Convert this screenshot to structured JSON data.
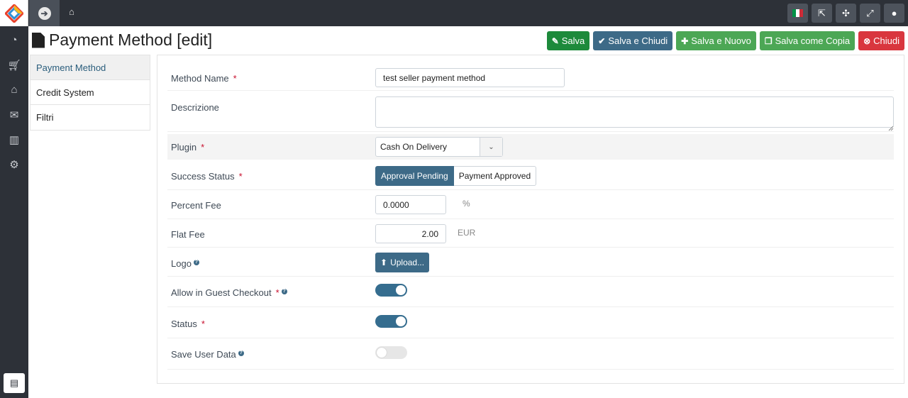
{
  "header": {
    "home_icon": "home-icon",
    "toggle_icon": "arrow-circle-right-icon",
    "right_icons": [
      "italian-flag-icon",
      "external-link-icon",
      "joomla-icon",
      "expand-icon",
      "user-icon"
    ],
    "flag_colors": [
      "#009246",
      "#ffffff",
      "#ce2b37"
    ]
  },
  "sidebar": {
    "icons": [
      "dashboard-icon",
      "cart-icon",
      "bank-icon",
      "envelope-icon",
      "bar-chart-icon",
      "gear-icon"
    ],
    "bottom_icon": "book-icon"
  },
  "page": {
    "title": "Payment Method [edit]"
  },
  "toolbar": {
    "save": "Salva",
    "save_close": "Salva e Chiudi",
    "save_new": "Salva e Nuovo",
    "save_copy": "Salva come Copia",
    "close": "Chiudi"
  },
  "tabs": [
    "Payment Method",
    "Credit System",
    "Filtri"
  ],
  "form": {
    "method_name": {
      "label": "Method Name",
      "required": "*",
      "value": "test seller payment method"
    },
    "description": {
      "label": "Descrizione",
      "value": ""
    },
    "plugin": {
      "label": "Plugin",
      "required": "*",
      "value": "Cash On Delivery"
    },
    "success_status": {
      "label": "Success Status",
      "required": "*",
      "options": [
        "Approval Pending",
        "Payment Approved"
      ],
      "selected": "Approval Pending"
    },
    "percent_fee": {
      "label": "Percent Fee",
      "value": "0.0000",
      "unit": "%"
    },
    "flat_fee": {
      "label": "Flat Fee",
      "value": "2.00",
      "unit": "EUR"
    },
    "logo": {
      "label": "Logo",
      "button": "Upload..."
    },
    "guest_checkout": {
      "label": "Allow in Guest Checkout",
      "required": "*",
      "on": true
    },
    "status": {
      "label": "Status",
      "required": "*",
      "on": true
    },
    "save_user_data": {
      "label": "Save User Data",
      "on": false
    }
  },
  "colors": {
    "primary": "#3d6a87",
    "save_green": "#1d8a3b",
    "light_green": "#4ca755",
    "danger": "#d9363e",
    "dark_bg": "#2d3138"
  }
}
